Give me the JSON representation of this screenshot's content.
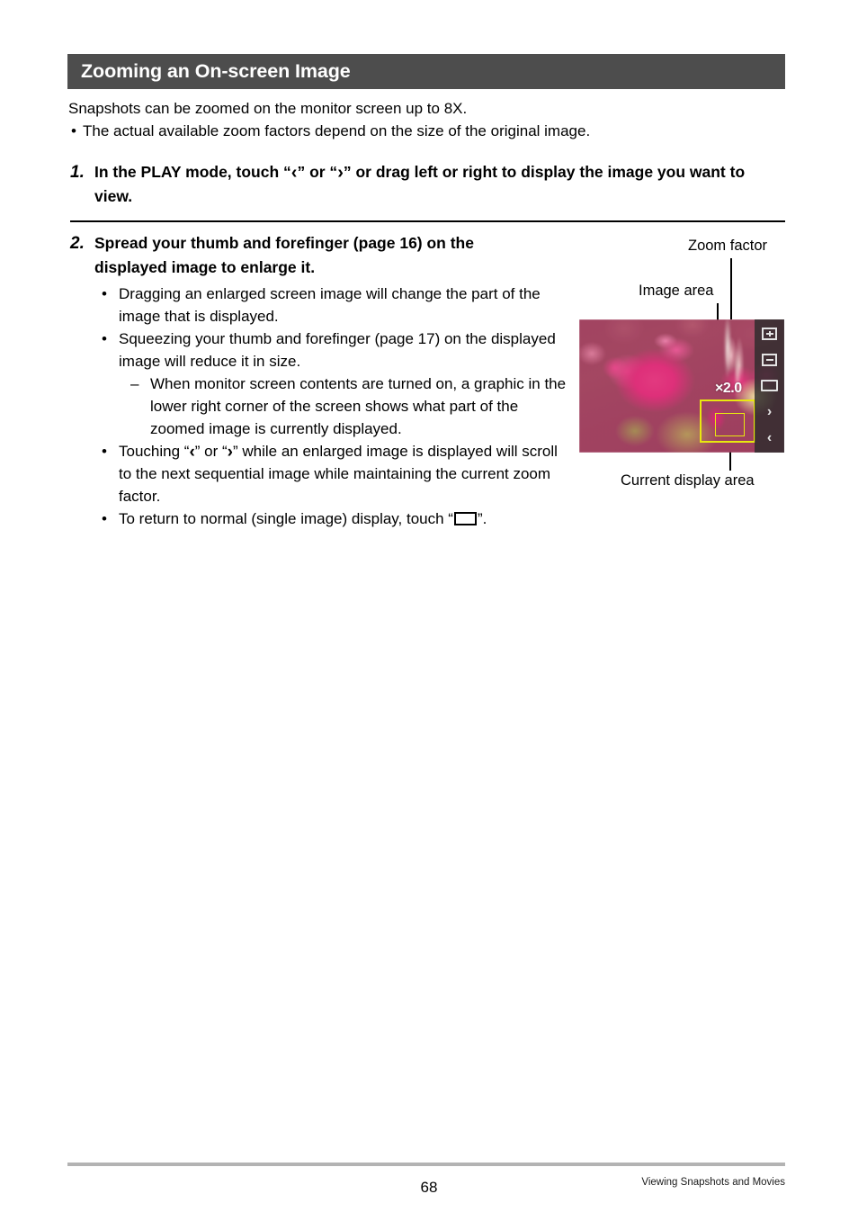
{
  "header": {
    "title": "Zooming an On-screen Image",
    "bar_color": "#4d4d4d"
  },
  "intro": {
    "line1": "Snapshots can be zoomed on the monitor screen up to 8X.",
    "bullet_marker": "•",
    "bullet1": "The actual available zoom factors depend on the size of the original image."
  },
  "steps": [
    {
      "number": "1.",
      "text_before": "In the PLAY mode, touch “",
      "glyph_a": "‹",
      "text_mid": "” or “",
      "glyph_b": "›",
      "text_after": "” or drag left or right to display the image you want to view."
    },
    {
      "number": "2.",
      "text": "Spread your thumb and forefinger (page 16) on the displayed image to enlarge it."
    }
  ],
  "sublist": {
    "bullet_marker": "•",
    "dash_marker": "–",
    "items": [
      {
        "kind": "bullet",
        "text": "Dragging an enlarged screen image will change the part of the image that is displayed."
      },
      {
        "kind": "bullet",
        "text": "Squeezing your thumb and forefinger (page 17) on the displayed image will reduce it in size."
      },
      {
        "kind": "dash",
        "text": "When monitor screen contents are turned on, a graphic in the lower right corner of the screen shows what part of the zoomed image is currently displayed."
      },
      {
        "kind": "bullet-glyphs",
        "text_before": "Touching “",
        "glyph_a": "‹",
        "text_mid": "” or “",
        "glyph_b": "›",
        "text_after": "” while an enlarged image is displayed will scroll to the next sequential image while maintaining the current zoom factor."
      },
      {
        "kind": "bullet-rect",
        "text_before": "To return to normal (single image) display, touch “",
        "icon": "rectangle-icon",
        "text_after": "”."
      }
    ]
  },
  "figure": {
    "zoom_factor_value": "×2.0",
    "controls": [
      {
        "name": "zoom-in-button",
        "glyph": "+"
      },
      {
        "name": "zoom-out-button",
        "glyph": "−"
      },
      {
        "name": "normal-display-button",
        "glyph": "▭"
      },
      {
        "name": "next-image-button",
        "glyph": "›"
      },
      {
        "name": "previous-image-button",
        "glyph": "‹"
      }
    ],
    "overlay_box_color": "#e8e80f",
    "callouts": {
      "zoom_factor": "Zoom factor",
      "image_area": "Image area",
      "current_display_area": "Current display area"
    }
  },
  "footer": {
    "page_number": "68",
    "chapter": "Viewing Snapshots and Movies",
    "rule_color": "#b3b3b3"
  }
}
